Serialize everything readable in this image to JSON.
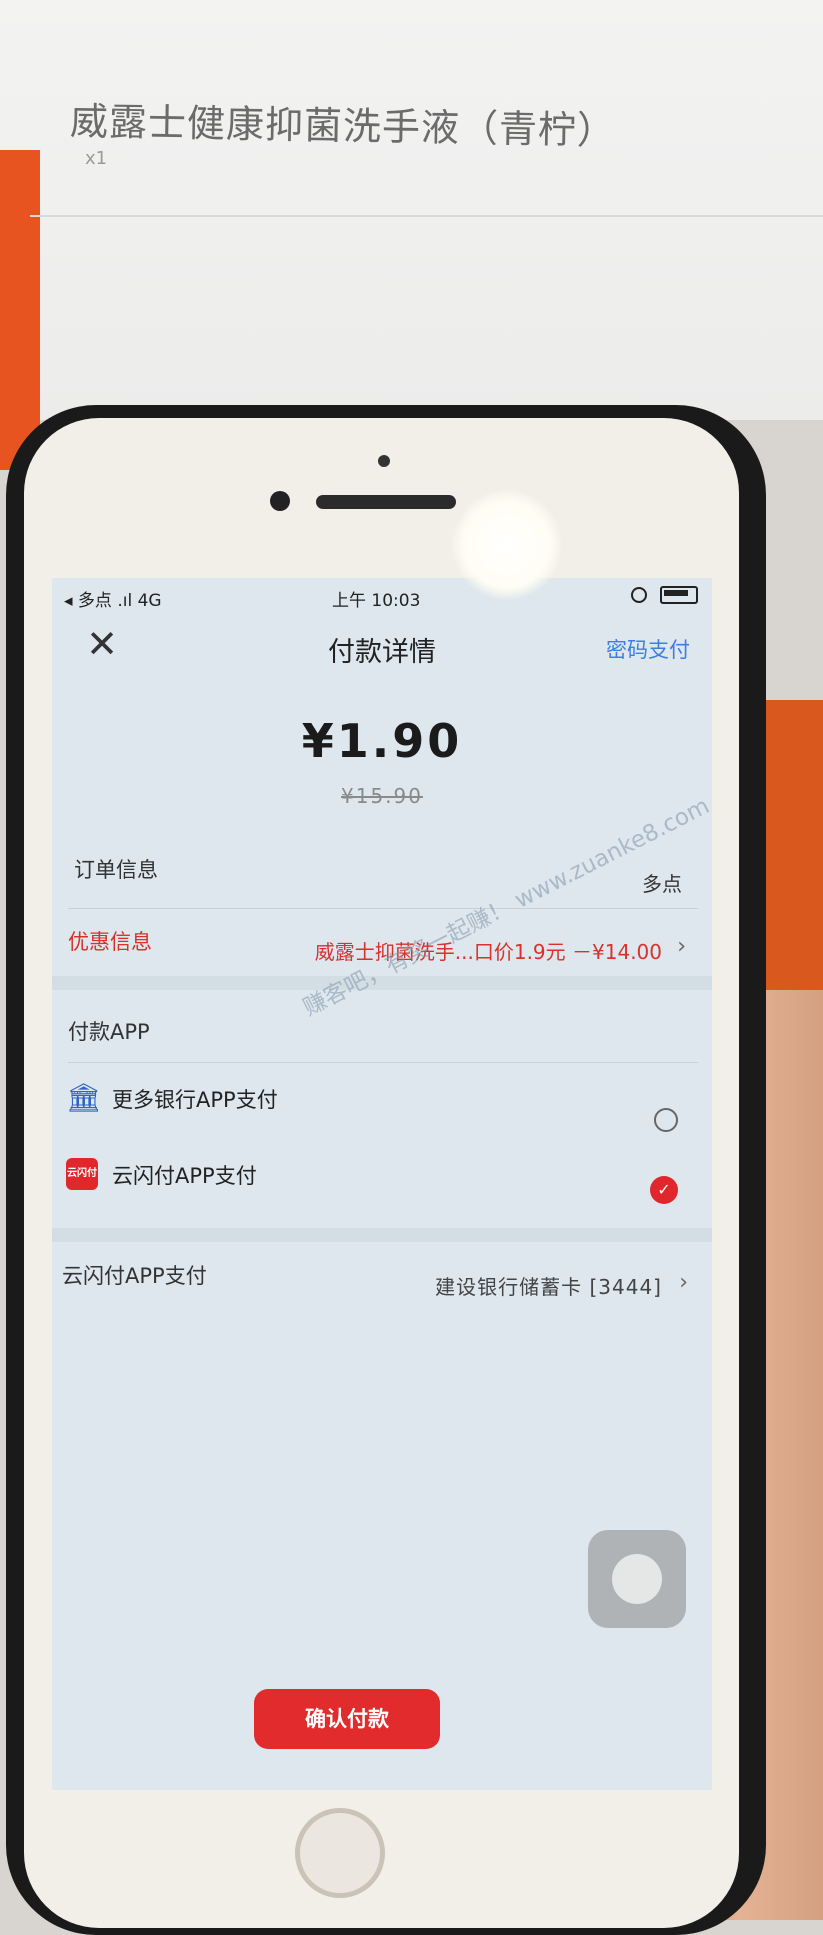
{
  "background": {
    "receipt_title": "威露士健康抑菌洗手液（青柠）",
    "receipt_qty": "x1"
  },
  "status_bar": {
    "carrier": "◂ 多点 .ıl 4G",
    "time": "上午 10:03"
  },
  "nav": {
    "close_symbol": "✕",
    "title": "付款详情",
    "password_pay": "密码支付"
  },
  "payment": {
    "amount": "¥1.90",
    "original_amount": "¥15.90"
  },
  "order_info": {
    "label": "订单信息",
    "value": "多点"
  },
  "discount_info": {
    "label": "优惠信息",
    "value": "威露士抑菌洗手...口价1.9元 －¥14.00"
  },
  "pay_app": {
    "section_title": "付款APP",
    "methods": [
      {
        "label": "更多银行APP支付",
        "icon": "bank-icon",
        "selected": false
      },
      {
        "label": "云闪付APP支付",
        "icon": "unionpay-icon",
        "selected": true
      }
    ]
  },
  "card": {
    "label": "云闪付APP支付",
    "value": "建设银行储蓄卡 [3444]"
  },
  "confirm_button": "确认付款",
  "watermark": "赚客吧，有奖一起赚！ www.zuanke8.com",
  "colors": {
    "accent_red": "#e12b2d",
    "link_blue": "#3d7ee0",
    "screen_bg": "#dde7ed"
  }
}
